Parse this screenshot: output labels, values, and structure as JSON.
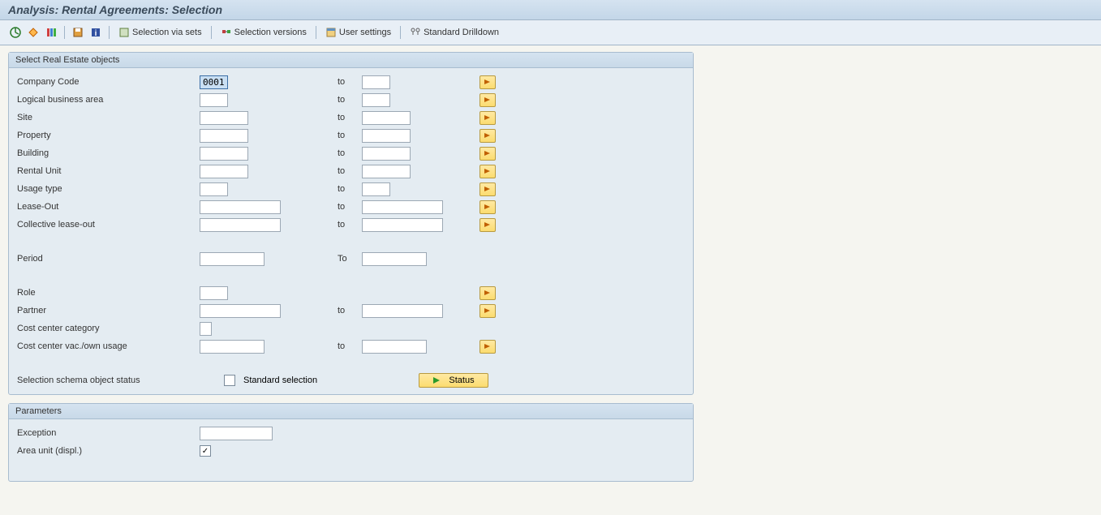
{
  "title": "Analysis: Rental Agreements: Selection",
  "toolbar": {
    "selection_via_sets": "Selection via sets",
    "selection_versions": "Selection versions",
    "user_settings": "User settings",
    "standard_drilldown": "Standard Drilldown"
  },
  "groups": {
    "realestate": {
      "title": "Select Real Estate objects",
      "rows": {
        "company_code": {
          "label": "Company Code",
          "from": "0001",
          "to_label": "to",
          "to": ""
        },
        "logical_ba": {
          "label": "Logical business area",
          "from": "",
          "to_label": "to",
          "to": ""
        },
        "site": {
          "label": "Site",
          "from": "",
          "to_label": "to",
          "to": ""
        },
        "property": {
          "label": "Property",
          "from": "",
          "to_label": "to",
          "to": ""
        },
        "building": {
          "label": "Building",
          "from": "",
          "to_label": "to",
          "to": ""
        },
        "rental_unit": {
          "label": "Rental Unit",
          "from": "",
          "to_label": "to",
          "to": ""
        },
        "usage_type": {
          "label": "Usage type",
          "from": "",
          "to_label": "to",
          "to": ""
        },
        "lease_out": {
          "label": "Lease-Out",
          "from": "",
          "to_label": "to",
          "to": ""
        },
        "coll_lease": {
          "label": "Collective lease-out",
          "from": "",
          "to_label": "to",
          "to": ""
        },
        "period": {
          "label": "Period",
          "from": "",
          "to_label": "To",
          "to": ""
        },
        "role": {
          "label": "Role",
          "from": ""
        },
        "partner": {
          "label": "Partner",
          "from": "",
          "to_label": "to",
          "to": ""
        },
        "cc_cat": {
          "label": "Cost center category",
          "from": ""
        },
        "cc_vac": {
          "label": "Cost center vac./own usage",
          "from": "",
          "to_label": "to",
          "to": ""
        },
        "schema": {
          "label": "Selection schema object status",
          "std_label": "Standard selection",
          "status_label": "Status"
        }
      }
    },
    "parameters": {
      "title": "Parameters",
      "exception": {
        "label": "Exception",
        "value": ""
      },
      "area_unit": {
        "label": "Area unit (displ.)",
        "checked": true
      }
    }
  }
}
